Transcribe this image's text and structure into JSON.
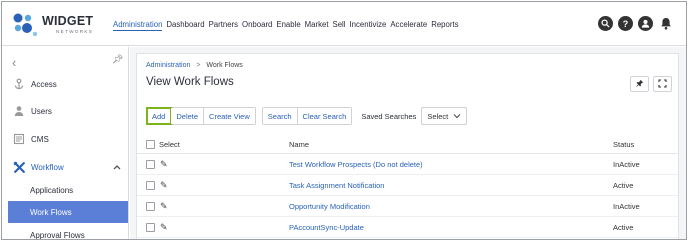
{
  "brand": {
    "name": "WIDGET",
    "sub": "NETWORKS"
  },
  "nav": [
    "Administration",
    "Dashboard",
    "Partners",
    "Onboard",
    "Enable",
    "Market",
    "Sell",
    "Incentivize",
    "Accelerate",
    "Reports"
  ],
  "top_icons": [
    "search-icon",
    "help-icon",
    "user-icon",
    "bell-icon"
  ],
  "sidebar": {
    "items": [
      {
        "label": "Access",
        "icon": "access-icon"
      },
      {
        "label": "Users",
        "icon": "users-icon"
      },
      {
        "label": "CMS",
        "icon": "cms-icon"
      },
      {
        "label": "Workflow",
        "icon": "workflow-icon"
      },
      {
        "label": "Applications"
      },
      {
        "label": "Work Flows"
      },
      {
        "label": "Approval Flows"
      }
    ]
  },
  "breadcrumb": {
    "root": "Administration",
    "separator": ">",
    "current": "Work Flows"
  },
  "page_title": "View Work Flows",
  "toolbar": {
    "add": "Add",
    "delete": "Delete",
    "create_view": "Create View",
    "search": "Search",
    "clear_search": "Clear Search",
    "saved_searches_label": "Saved Searches",
    "select_value": "Select"
  },
  "table": {
    "headers": {
      "select": "Select",
      "name": "Name",
      "status": "Status"
    },
    "rows": [
      {
        "name": "Test Workflow Prospects (Do not delete)",
        "status": "InActive"
      },
      {
        "name": "Task Assignment Notification",
        "status": "Active"
      },
      {
        "name": "Opportunity Modification",
        "status": "InActive"
      },
      {
        "name": "PAccountSync-Update",
        "status": "Active"
      }
    ]
  },
  "colors": {
    "accent": "#2a62b8",
    "selected_bg": "#5b7fd6",
    "highlight": "#7bb31a"
  }
}
